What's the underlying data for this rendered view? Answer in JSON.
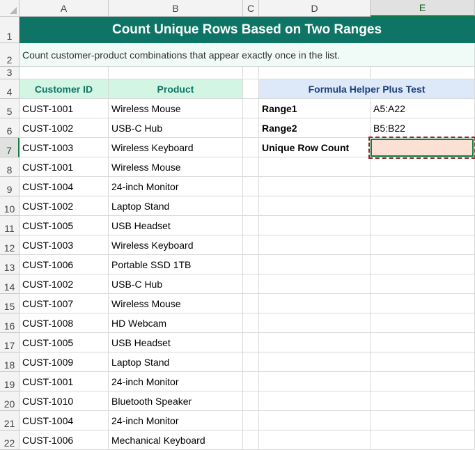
{
  "columns": [
    "A",
    "B",
    "C",
    "D",
    "E"
  ],
  "title": "Count Unique Rows Based on Two Ranges",
  "subtitle": "Count customer-product combinations that appear exactly once in the list.",
  "table": {
    "headers": [
      "Customer ID",
      "Product"
    ],
    "rows": [
      [
        "CUST-1001",
        "Wireless Mouse"
      ],
      [
        "CUST-1002",
        "USB-C Hub"
      ],
      [
        "CUST-1003",
        "Wireless Keyboard"
      ],
      [
        "CUST-1001",
        "Wireless Mouse"
      ],
      [
        "CUST-1004",
        "24-inch Monitor"
      ],
      [
        "CUST-1002",
        "Laptop Stand"
      ],
      [
        "CUST-1005",
        "USB Headset"
      ],
      [
        "CUST-1003",
        "Wireless Keyboard"
      ],
      [
        "CUST-1006",
        "Portable SSD 1TB"
      ],
      [
        "CUST-1002",
        "USB-C Hub"
      ],
      [
        "CUST-1007",
        "Wireless Mouse"
      ],
      [
        "CUST-1008",
        "HD Webcam"
      ],
      [
        "CUST-1005",
        "USB Headset"
      ],
      [
        "CUST-1009",
        "Laptop Stand"
      ],
      [
        "CUST-1001",
        "24-inch Monitor"
      ],
      [
        "CUST-1010",
        "Bluetooth Speaker"
      ],
      [
        "CUST-1004",
        "24-inch Monitor"
      ],
      [
        "CUST-1006",
        "Mechanical Keyboard"
      ]
    ]
  },
  "helper": {
    "title": "Formula Helper Plus Test",
    "fields": [
      {
        "label": "Range1",
        "value": "A5:A22"
      },
      {
        "label": "Range2",
        "value": "B5:B22"
      },
      {
        "label": "Unique Row Count",
        "value": ""
      }
    ]
  },
  "selected_cell": "E7",
  "colors": {
    "title_bg": "#0e7566",
    "header_green_bg": "#d3f5e4",
    "header_blue_bg": "#dde9f8",
    "active_cell_bg": "#fbe1d3",
    "selection_border": "#107c41"
  }
}
